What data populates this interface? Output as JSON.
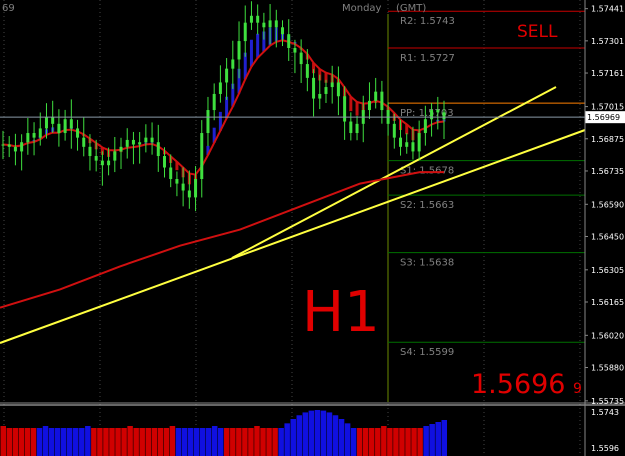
{
  "chart_data": {
    "type": "candlestick",
    "timeframe": "H1",
    "top_labels": [
      "69",
      "Monday",
      "(GMT)"
    ],
    "signal": "SELL",
    "current_price": "1.5696",
    "current_price_suffix": "9",
    "bid_tag": "1.56969",
    "y_ticks": [
      "1.57441",
      "1.57301",
      "1.57161",
      "1.57015",
      "1.56875",
      "1.56735",
      "1.56590",
      "1.56450",
      "1.56305",
      "1.56165",
      "1.56020",
      "1.55880",
      "1.55735"
    ],
    "ylim": [
      1.5573,
      1.5747
    ],
    "pivots": [
      {
        "label": "R2:",
        "value": "1.5743",
        "level": 1.5743,
        "color": "#c80000"
      },
      {
        "label": "R1:",
        "value": "1.5727",
        "level": 1.5727,
        "color": "#c80000"
      },
      {
        "label": "PP:",
        "value": "1.5703",
        "level": 1.5703,
        "color": "#ff8000"
      },
      {
        "label": "S1:",
        "value": "1.5678",
        "level": 1.5678,
        "color": "#007000"
      },
      {
        "label": "S2:",
        "value": "1.5663",
        "level": 1.5663,
        "color": "#007000"
      },
      {
        "label": "S3:",
        "value": "1.5638",
        "level": 1.5638,
        "color": "#007000"
      },
      {
        "label": "S4:",
        "value": "1.5599",
        "level": 1.5599,
        "color": "#007000"
      }
    ],
    "close_series": [
      1.5685,
      1.5684,
      1.5682,
      1.5686,
      1.569,
      1.5688,
      1.5692,
      1.5697,
      1.5694,
      1.569,
      1.5696,
      1.5692,
      1.5688,
      1.5684,
      1.568,
      1.5678,
      1.5676,
      1.5678,
      1.5682,
      1.5684,
      1.5687,
      1.5685,
      1.5686,
      1.5688,
      1.5686,
      1.568,
      1.5675,
      1.567,
      1.5668,
      1.5665,
      1.5662,
      1.567,
      1.569,
      1.57,
      1.5707,
      1.5712,
      1.5718,
      1.5722,
      1.573,
      1.5738,
      1.5741,
      1.5738,
      1.5736,
      1.5739,
      1.5736,
      1.5733,
      1.5727,
      1.5725,
      1.572,
      1.5714,
      1.5705,
      1.5707,
      1.571,
      1.5712,
      1.5706,
      1.5695,
      1.569,
      1.5694,
      1.57,
      1.5704,
      1.5708,
      1.57,
      1.5694,
      1.5688,
      1.5684,
      1.5686,
      1.5682,
      1.569,
      1.5696,
      1.57,
      1.5699,
      1.5696
    ],
    "histogram_scale": [
      "1.5743",
      "1.5596"
    ],
    "histogram_colors": [
      "#d00000",
      "#1010e0"
    ]
  }
}
